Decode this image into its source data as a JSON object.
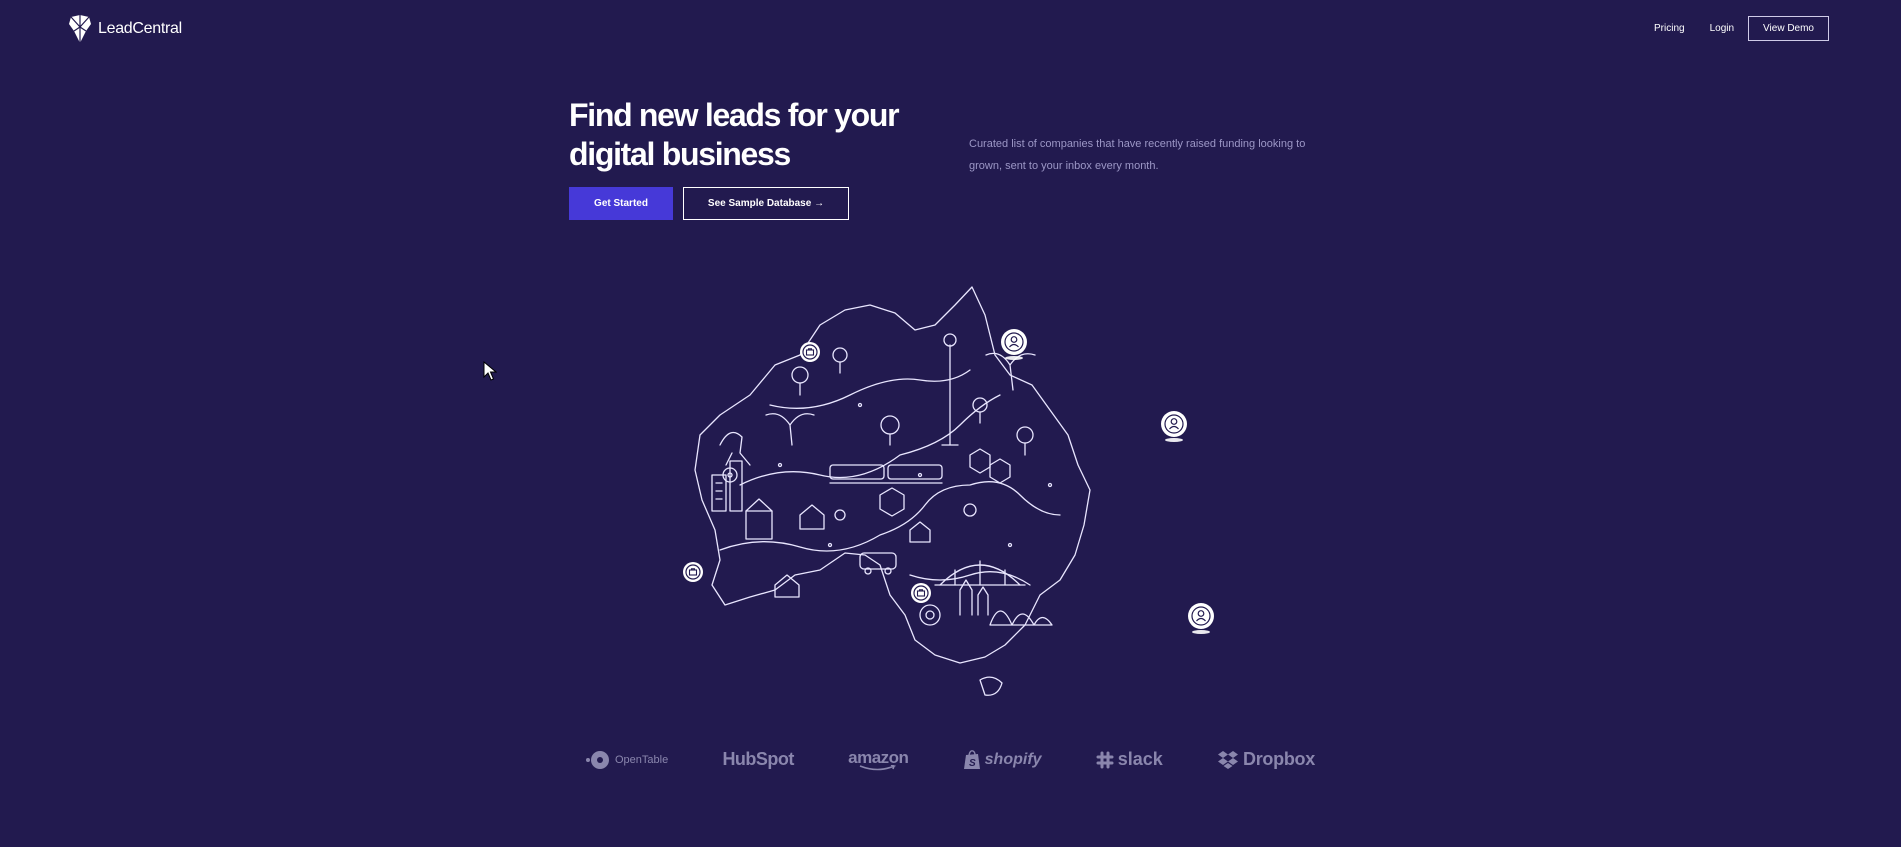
{
  "brand": {
    "name": "LeadCentral",
    "logo_icon": "fox-head-logo-icon"
  },
  "nav": {
    "pricing": "Pricing",
    "login": "Login",
    "demo": "View Demo"
  },
  "hero": {
    "headline": "Find new leads for your digital business",
    "subtext": "Curated list of companies that have recently raised funding looking to grown, sent to your inbox every month.",
    "primary_cta": "Get Started",
    "secondary_cta": "See Sample Database →"
  },
  "map": {
    "illustration": "australia-line-art-map",
    "pins": [
      "briefcase-icon",
      "person-icon",
      "person-icon",
      "briefcase-icon",
      "briefcase-icon",
      "person-icon"
    ]
  },
  "logos": [
    {
      "name": "OpenTable",
      "icon": "opentable-dot-icon"
    },
    {
      "name": "HubSpot",
      "icon": ""
    },
    {
      "name": "amazon",
      "icon": "amazon-smile-icon"
    },
    {
      "name": "shopify",
      "icon": "shopify-bag-icon"
    },
    {
      "name": "slack",
      "icon": "slack-hash-icon"
    },
    {
      "name": "Dropbox",
      "icon": "dropbox-box-icon"
    }
  ],
  "colors": {
    "background": "#221a4f",
    "accent": "#4639d8",
    "muted_text": "#9c97c6",
    "logo_gray": "#8a86ad"
  }
}
